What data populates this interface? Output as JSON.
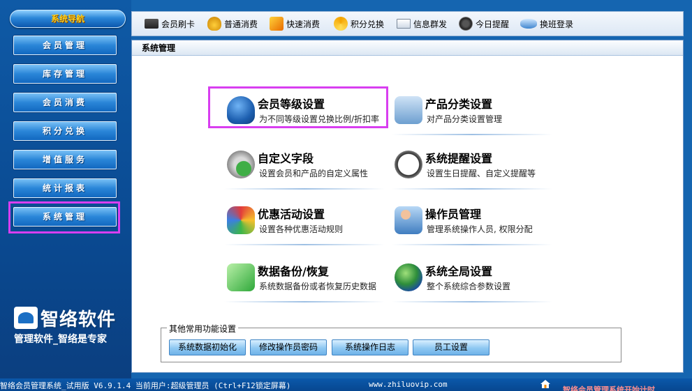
{
  "sidebar": {
    "title": "系统导航",
    "items": [
      {
        "label": "会员管理"
      },
      {
        "label": "库存管理"
      },
      {
        "label": "会员消费"
      },
      {
        "label": "积分兑换"
      },
      {
        "label": "增值服务"
      },
      {
        "label": "统计报表"
      },
      {
        "label": "系统管理"
      }
    ],
    "selected": "系统管理",
    "logo_name": "智络软件",
    "logo_slogan": "管理软件_智络是专家"
  },
  "toolbar": {
    "items": [
      {
        "label": "会员刷卡",
        "icon": "card-reader-icon"
      },
      {
        "label": "普通消费",
        "icon": "money-bag-icon"
      },
      {
        "label": "快速消费",
        "icon": "fast-pay-icon"
      },
      {
        "label": "积分兑换",
        "icon": "points-exchange-icon"
      },
      {
        "label": "信息群发",
        "icon": "mail-icon"
      },
      {
        "label": "今日提醒",
        "icon": "reminder-icon"
      },
      {
        "label": "换班登录",
        "icon": "shift-login-icon"
      }
    ]
  },
  "panel": {
    "title": "系统管理",
    "functions": [
      {
        "title": "会员等级设置",
        "desc": "为不同等级设置兑换比例/折扣率",
        "icon": "member-level-icon"
      },
      {
        "title": "产品分类设置",
        "desc": "对产品分类设置管理",
        "icon": "product-category-icon"
      },
      {
        "title": "自定义字段",
        "desc": "设置会员和产品的自定义属性",
        "icon": "custom-field-icon"
      },
      {
        "title": "系统提醒设置",
        "desc": "设置生日提醒、自定义提醒等",
        "icon": "clock-icon"
      },
      {
        "title": "优惠活动设置",
        "desc": "设置各种优惠活动规则",
        "icon": "promotion-icon"
      },
      {
        "title": "操作员管理",
        "desc": "管理系统操作人员, 权限分配",
        "icon": "operator-icon"
      },
      {
        "title": "数据备份/恢复",
        "desc": "系统数据备份或者恢复历史数据",
        "icon": "backup-icon"
      },
      {
        "title": "系统全局设置",
        "desc": "整个系统综合参数设置",
        "icon": "globe-icon"
      }
    ],
    "highlighted": "会员等级设置",
    "other_legend": "其他常用功能设置",
    "other_buttons": [
      {
        "label": "系统数据初始化"
      },
      {
        "label": "修改操作员密码"
      },
      {
        "label": "系统操作日志"
      },
      {
        "label": "员工设置"
      }
    ]
  },
  "status": {
    "text": "智络会员管理系统_试用版 V6.9.1.4 当前用户:超级管理员 (Ctrl+F12锁定屏幕)",
    "url": "www.zhiluovip.com",
    "scroll_notice": "智络会员管理系统开始计时"
  },
  "colors": {
    "highlight": "#d83ef0",
    "sidebar_bg": "#0f5aa6",
    "nav_title_text": "#ffd21c"
  }
}
